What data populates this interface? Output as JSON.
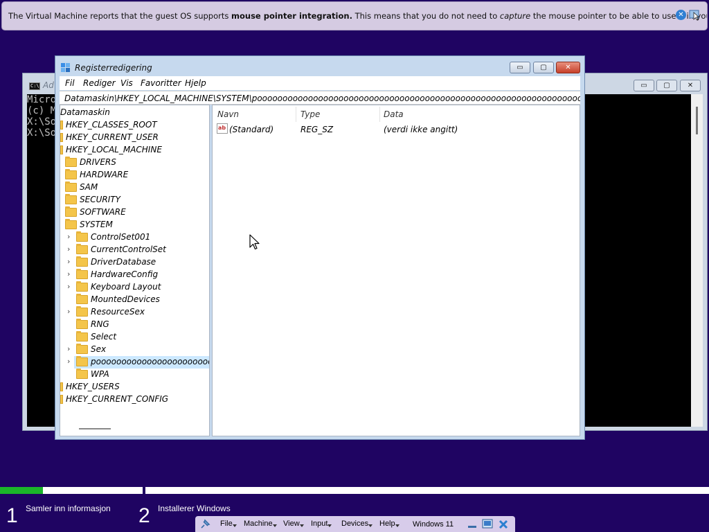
{
  "vbox_banner": {
    "text_1": "The Virtual Machine reports that the guest OS supports ",
    "text_bold": "mouse pointer integration.",
    "text_2": " This means that you do not need to ",
    "text_italic": "capture",
    "text_3": " the mouse pointer to be able to use it in your guest OS -- all mouse"
  },
  "cmd": {
    "title": "Ad",
    "icon_text": "C:\\",
    "lines": [
      "Micro",
      "(c) M",
      "",
      "X:\\So",
      "",
      "X:\\So"
    ],
    "minimize": "▭",
    "maximize": "▢",
    "close": "✕"
  },
  "regedit": {
    "title": "Registerredigering",
    "menu": [
      "Fil",
      "Rediger",
      "Vis",
      "Favoritter",
      "Hjelp"
    ],
    "address": "Datamaskin\\HKEY_LOCAL_MACHINE\\SYSTEM\\poooooooooooooooooooooooooooooooooooooooooooooooooooooooooooooooooooooooooooooooooooooooooooo",
    "minimize": "▭",
    "maximize": "▢",
    "close": "✕",
    "tree": {
      "root": "Datamaskin",
      "hives": [
        "HKEY_CLASSES_ROOT",
        "HKEY_CURRENT_USER",
        "HKEY_LOCAL_MACHINE"
      ],
      "hklm_children": [
        "DRIVERS",
        "HARDWARE",
        "SAM",
        "SECURITY",
        "SOFTWARE",
        "SYSTEM"
      ],
      "system_children": [
        "ControlSet001",
        "CurrentControlSet",
        "DriverDatabase",
        "HardwareConfig",
        "Keyboard Layout",
        "MountedDevices",
        "ResourceSex",
        "RNG",
        "Select",
        "Sex",
        "pooooooooooooooooooooooooooo",
        "WPA"
      ],
      "bottom_hives": [
        "HKEY_USERS",
        "HKEY_CURRENT_CONFIG"
      ]
    },
    "columns": [
      "Navn",
      "Type",
      "Data"
    ],
    "values": [
      {
        "name": "(Standard)",
        "type": "REG_SZ",
        "data": "(verdi ikke angitt)",
        "icon": "ab"
      }
    ]
  },
  "setup": {
    "progress_step1_fraction": 0.3,
    "steps": [
      {
        "number": "1",
        "label": "Samler inn informasjon"
      },
      {
        "number": "2",
        "label": "Installerer Windows"
      }
    ]
  },
  "vbox_toolbar": {
    "items": [
      "File",
      "Machine",
      "View",
      "Input",
      "Devices",
      "Help"
    ],
    "vm_name": "Windows 11"
  },
  "colors": {
    "desktop_bg": "#1f0462",
    "progress_green": "#1bb52a",
    "selection": "#cce8ff"
  }
}
